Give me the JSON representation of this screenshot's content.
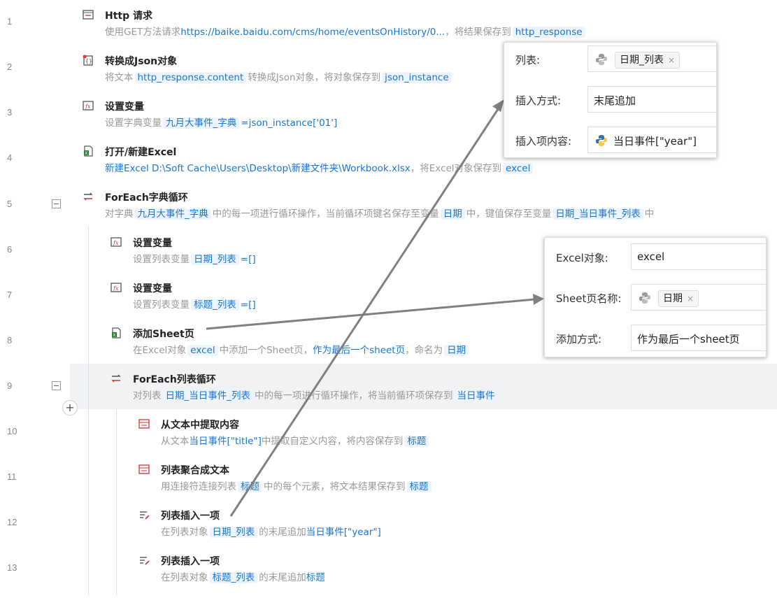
{
  "line_numbers": [
    "1",
    "2",
    "3",
    "4",
    "5",
    "6",
    "7",
    "8",
    "9",
    "10",
    "11",
    "12",
    "13"
  ],
  "steps": [
    {
      "title": "Http 请求",
      "d": [
        "使用GET方法请求",
        "https://baike.baidu.com/cms/home/eventsOnHistory/0...",
        "，将结果保存到",
        "http_response"
      ]
    },
    {
      "title": "转换成Json对象",
      "d": [
        "将文本",
        "http_response.content",
        "转换成Json对象，将对象保存到",
        "json_instance"
      ]
    },
    {
      "title": "设置变量",
      "d": [
        "设置字典变量",
        "九月大事件_字典",
        "=",
        "json_instance['01']"
      ]
    },
    {
      "title": "打开/新建Excel",
      "d": [
        "新建Excel D:\\Soft Cache\\Users\\Desktop\\新建文件夹\\Workbook.xlsx",
        "，将Excel对象保存到",
        "excel"
      ]
    },
    {
      "title": "ForEach字典循环",
      "d": [
        "对字典",
        "九月大事件_字典",
        "中的每一项进行循环操作，当前循环项键名保存至变量",
        "日期",
        "中，键值保存至变量",
        "日期_当日事件_列表",
        "中"
      ]
    },
    {
      "title": "设置变量",
      "d": [
        "设置列表变量",
        "日期_列表",
        "=",
        "[]"
      ]
    },
    {
      "title": "设置变量",
      "d": [
        "设置列表变量",
        "标题_列表",
        "=",
        "[]"
      ]
    },
    {
      "title": "添加Sheet页",
      "d": [
        "在Excel对象",
        "excel",
        "中添加一个Sheet页，",
        "作为最后一个sheet页",
        "，命名为",
        "日期"
      ]
    },
    {
      "title": "ForEach列表循环",
      "d": [
        "对列表",
        "日期_当日事件_列表",
        "中的每一项进行循环操作，将当前循环项保存到",
        "当日事件"
      ]
    },
    {
      "title": "从文本中提取内容",
      "d": [
        "从文本",
        "当日事件[\"title\"]",
        "中提取自定义内容，将内容保存到",
        "标题"
      ]
    },
    {
      "title": "列表聚合成文本",
      "d": [
        "用连接符连接列表",
        "标题",
        "中的每个元素，将文本结果保存到",
        "标题"
      ]
    },
    {
      "title": "列表插入一项",
      "d": [
        "在列表对象",
        "日期_列表",
        "的末尾追加",
        "当日事件[\"year\"]"
      ]
    },
    {
      "title": "列表插入一项",
      "d": [
        "在列表对象",
        "标题_列表",
        "的末尾追加",
        "标题"
      ]
    }
  ],
  "panel1": {
    "rows": [
      {
        "label": "列表:",
        "value": "日期_列表",
        "close": "×"
      },
      {
        "label": "插入方式:",
        "value": "末尾追加"
      },
      {
        "label": "插入项内容:",
        "value": "当日事件[\"year\"]"
      }
    ]
  },
  "panel2": {
    "rows": [
      {
        "label": "Excel对象:",
        "value": "excel"
      },
      {
        "label": "Sheet页名称:",
        "value": "日期",
        "close": "×"
      },
      {
        "label": "添加方式:",
        "value": "作为最后一个sheet页"
      }
    ]
  },
  "add_button": "+",
  "colors": {
    "accent": "#1976d2",
    "tag_bg": "#eef4fd",
    "selected_row": "#f1f2f4",
    "arrow": "#808080"
  }
}
